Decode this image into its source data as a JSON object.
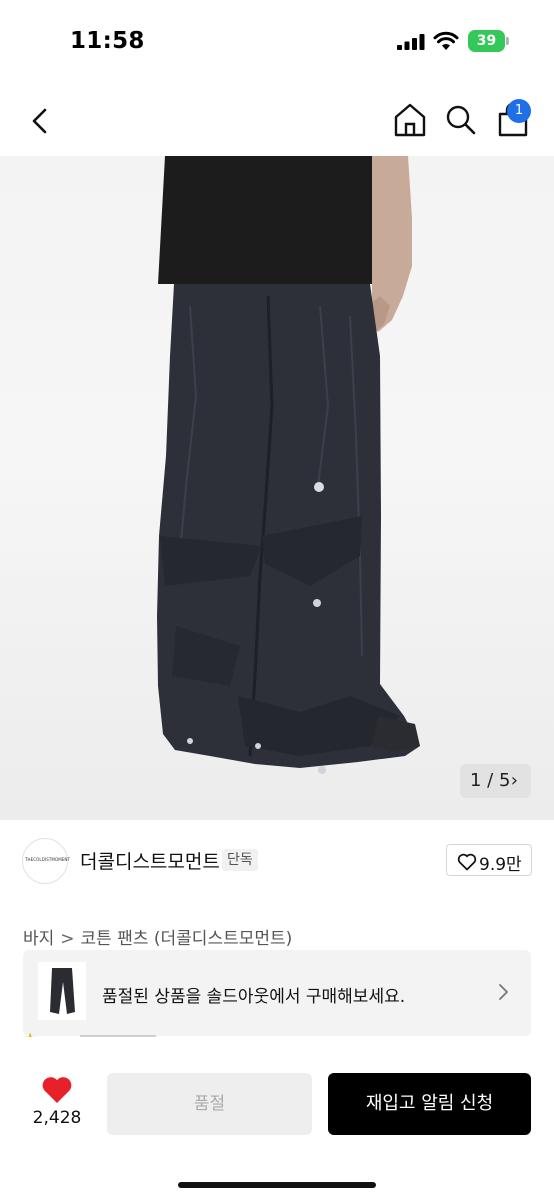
{
  "status_bar": {
    "time": "11:58",
    "battery": "39",
    "icons": [
      "signal-icon",
      "wifi-icon",
      "battery-icon"
    ]
  },
  "nav": {
    "icons": [
      "back-arrow-icon",
      "home-icon",
      "search-icon",
      "shopping-bag-icon"
    ],
    "cart_badge": "1"
  },
  "gallery": {
    "counter": "1 / 5"
  },
  "brand": {
    "logo_text": "THECOLDISTMOMENT",
    "name": "더콜디스트모먼트",
    "badge": "단독",
    "likes": "9.9만"
  },
  "breadcrumb": {
    "items": [
      "바지",
      "코튼 팬츠 (더콜디스트모먼트)"
    ],
    "separator": ">"
  },
  "soldout_banner": {
    "text": "품절된 상품을 솔드아웃에서 구매해보세요."
  },
  "bottom_bar": {
    "like_count": "2,428",
    "soldout_label": "품절",
    "restock_label": "재입고 알림 신청"
  },
  "colors": {
    "accent_blue": "#1f6fe8",
    "heart_red": "#e8202a",
    "battery_green": "#34c759",
    "primary_button": "#000000"
  }
}
